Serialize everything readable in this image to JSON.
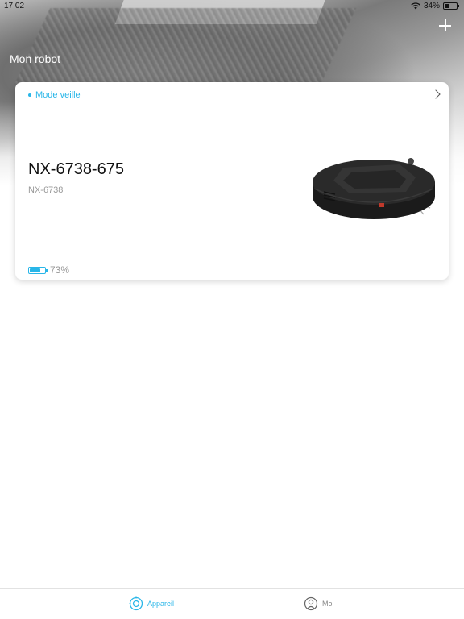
{
  "status_bar": {
    "time": "17:02",
    "battery_percent": "34%"
  },
  "header": {
    "title": "Mon robot",
    "add_icon": "plus-icon"
  },
  "device_card": {
    "status": "Mode veille",
    "name": "NX-6738-675",
    "model": "NX-6738",
    "battery_text": "73%",
    "battery_level": 0.73,
    "chevron_icon": "chevron-right-icon",
    "image": "robot-vacuum-image"
  },
  "tabs": [
    {
      "label": "Appareil",
      "icon": "device-target-icon",
      "active": true
    },
    {
      "label": "Moi",
      "icon": "user-icon",
      "active": false
    }
  ],
  "colors": {
    "accent": "#29b6e8",
    "muted": "#999999"
  }
}
